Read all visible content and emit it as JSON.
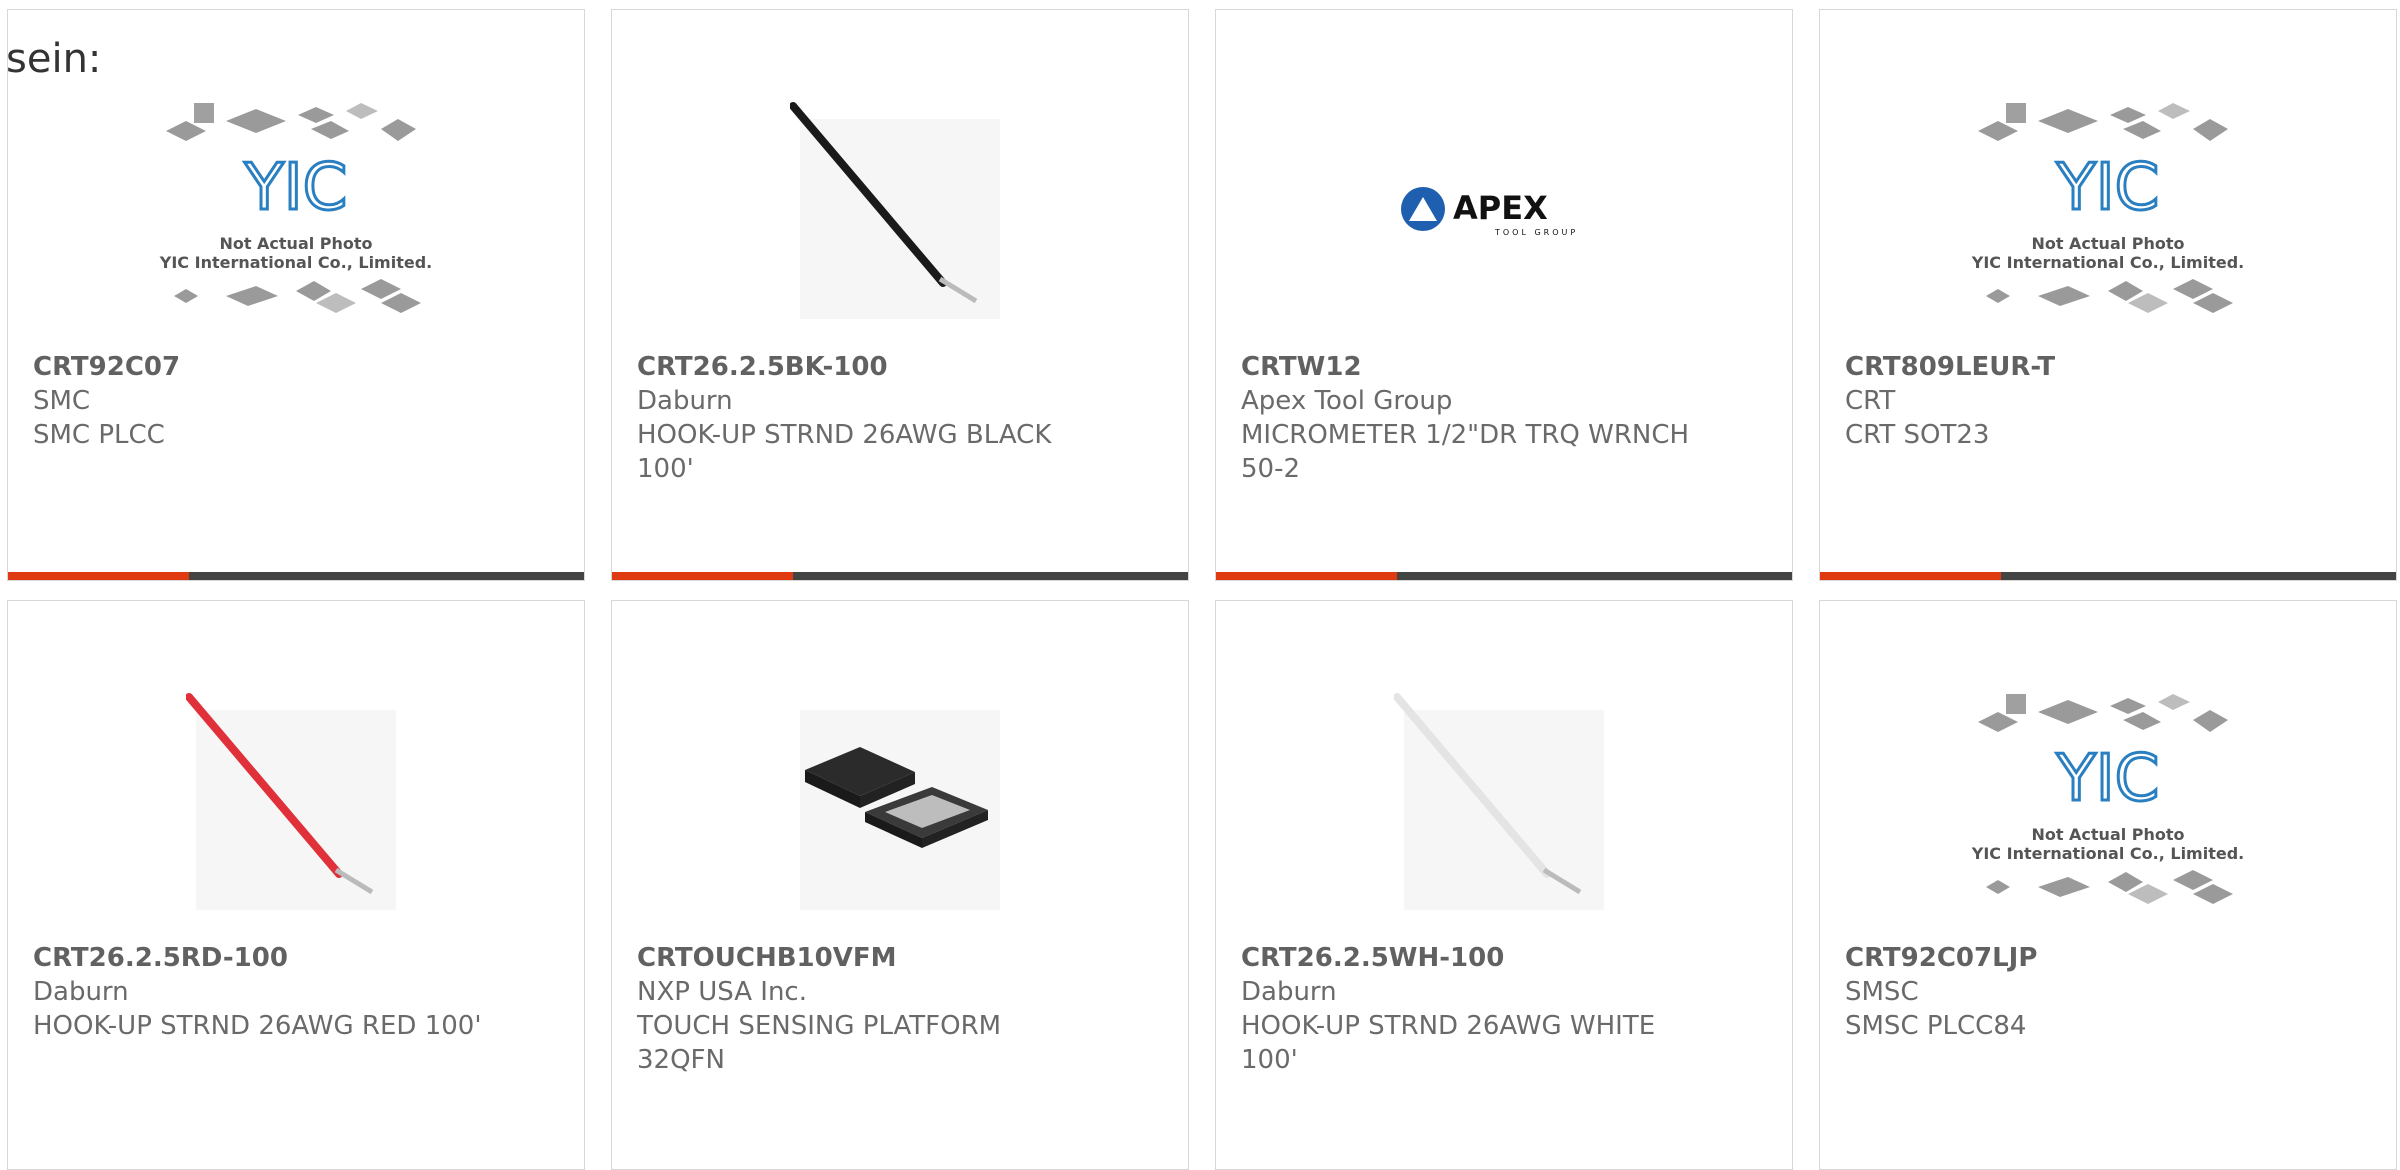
{
  "intro_text": "sein:",
  "placeholder_image": {
    "line1": "Not Actual Photo",
    "line2": "YIC International Co., Limited.",
    "logo": "YIC"
  },
  "apex_logo": {
    "name": "APEX",
    "sub": "TOOL GROUP"
  },
  "colors": {
    "accent": "#e03a12",
    "bar": "#444444",
    "text": "#6a6a6a",
    "border": "#d8d8d8"
  },
  "products": [
    {
      "part": "CRT92C07",
      "maker": "SMC",
      "desc": "SMC PLCC",
      "image": "placeholder-image"
    },
    {
      "part": "CRT26.2.5BK-100",
      "maker": "Daburn",
      "desc": "HOOK-UP STRND 26AWG BLACK 100'",
      "image": "black-wire"
    },
    {
      "part": "CRTW12",
      "maker": "Apex Tool Group",
      "desc": "MICROMETER 1/2\"DR TRQ WRNCH 50-2",
      "image": "apex-logo"
    },
    {
      "part": "CRT809LEUR-T",
      "maker": "CRT",
      "desc": "CRT SOT23",
      "image": "placeholder-image"
    },
    {
      "part": "CRT26.2.5RD-100",
      "maker": "Daburn",
      "desc": "HOOK-UP STRND 26AWG RED 100'",
      "image": "red-wire"
    },
    {
      "part": "CRTOUCHB10VFM",
      "maker": "NXP USA Inc.",
      "desc": "TOUCH SENSING PLATFORM 32QFN",
      "image": "qfn-chip"
    },
    {
      "part": "CRT26.2.5WH-100",
      "maker": "Daburn",
      "desc": "HOOK-UP STRND 26AWG WHITE 100'",
      "image": "white-wire"
    },
    {
      "part": "CRT92C07LJP",
      "maker": "SMSC",
      "desc": "SMSC PLCC84",
      "image": "placeholder-image"
    }
  ]
}
